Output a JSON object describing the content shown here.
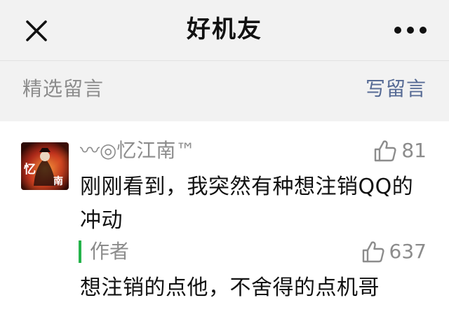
{
  "header": {
    "title": "好机友",
    "close_icon": "close-icon",
    "more_icon": "more-icon"
  },
  "section": {
    "title": "精选留言",
    "write_label": "写留言",
    "link_color": "#576b95"
  },
  "comment": {
    "nickname": "〰◎忆江南™",
    "likes": "81",
    "content": "刚刚看到，我突然有种想注销QQ的冲动",
    "avatar_text": "忆江南",
    "reply": {
      "label": "作者",
      "likes": "637",
      "content": "想注销的点他，不舍得的点机哥",
      "accent_color": "#24b34a"
    }
  }
}
